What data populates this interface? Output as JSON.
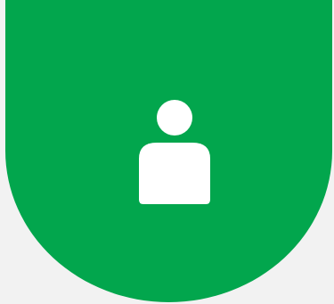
{
  "avatar": {
    "icon": "user-icon",
    "background_color": "#02a64d",
    "icon_color": "#ffffff"
  },
  "page": {
    "background_color": "#f2f2f2"
  }
}
